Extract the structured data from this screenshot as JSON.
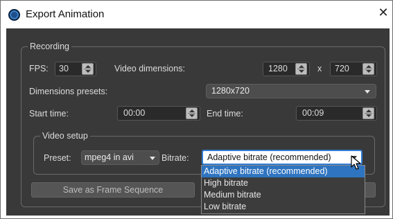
{
  "window": {
    "title": "Export Animation",
    "icon": "app-logo-icon",
    "close_icon": "close-icon"
  },
  "recording": {
    "group_title": "Recording",
    "fps_label": "FPS:",
    "fps_value": "30",
    "video_dimensions_label": "Video dimensions:",
    "width_value": "1280",
    "x_separator": "x",
    "height_value": "720",
    "dimensions_presets_label": "Dimensions presets:",
    "dimensions_preset_value": "1280x720",
    "start_time_label": "Start time:",
    "start_time_value": "00:00",
    "end_time_label": "End time:",
    "end_time_value": "00:09"
  },
  "video_setup": {
    "group_title": "Video setup",
    "preset_label": "Preset:",
    "preset_value": "mpeg4 in avi",
    "bitrate_label": "Bitrate:",
    "bitrate_value": "Adaptive bitrate (recommended)",
    "bitrate_options": [
      "Adaptive bitrate (recommended)",
      "High bitrate",
      "Medium bitrate",
      "Low bitrate"
    ],
    "selected_option_index": 0
  },
  "actions": {
    "save_frames_label": "Save as Frame Sequence"
  },
  "colors": {
    "panel_bg": "#393939",
    "accent": "#2f74c0",
    "focus_border": "#2f7bd4"
  }
}
